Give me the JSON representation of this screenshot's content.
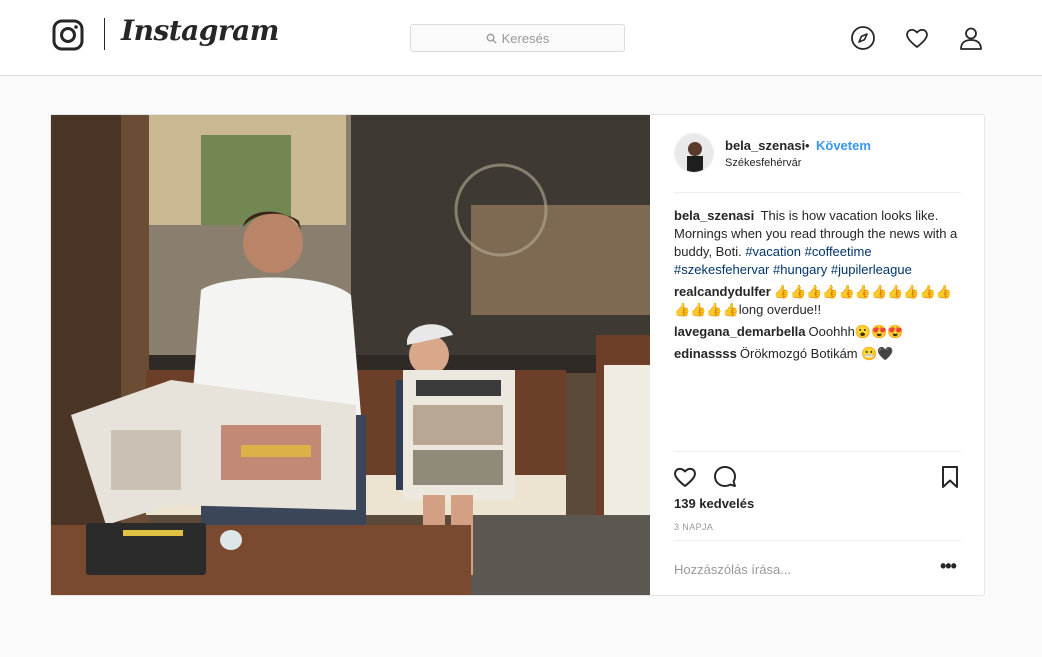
{
  "brand": {
    "wordmark": "Instagram"
  },
  "search": {
    "placeholder": "Keresés"
  },
  "nav": {
    "icons": [
      "explore-compass-icon",
      "activity-heart-icon",
      "profile-icon"
    ]
  },
  "post": {
    "author": "bela_szenasi",
    "separator": "•",
    "follow_label": "Követem",
    "location": "Székesfehérvár",
    "caption": {
      "user": "bela_szenasi",
      "text": "This is how vacation looks like. Mornings when you read through the news with a buddy, Boti.",
      "hashtags": [
        "#vacation",
        "#coffeetime",
        "#szekesfehervar",
        "#hungary",
        "#jupilerleague"
      ]
    },
    "comments": [
      {
        "user": "realcandydulfer",
        "text": "👍👍👍👍👍👍👍👍👍👍👍👍👍👍👍long overdue!!"
      },
      {
        "user": "lavegana_demarbella",
        "text": "Ooohhh😮😍😍"
      },
      {
        "user": "edinassss",
        "text": "Örökmozgó Botikám 😬🖤"
      }
    ],
    "likes": "139 kedvelés",
    "time": "3 NAPJA",
    "add_comment_placeholder": "Hozzászólás írása...",
    "more_label": "•••"
  },
  "colors": {
    "link_blue": "#3897f0",
    "hashtag": "#003569",
    "border": "#dbdbdb",
    "background": "#fafafa"
  }
}
